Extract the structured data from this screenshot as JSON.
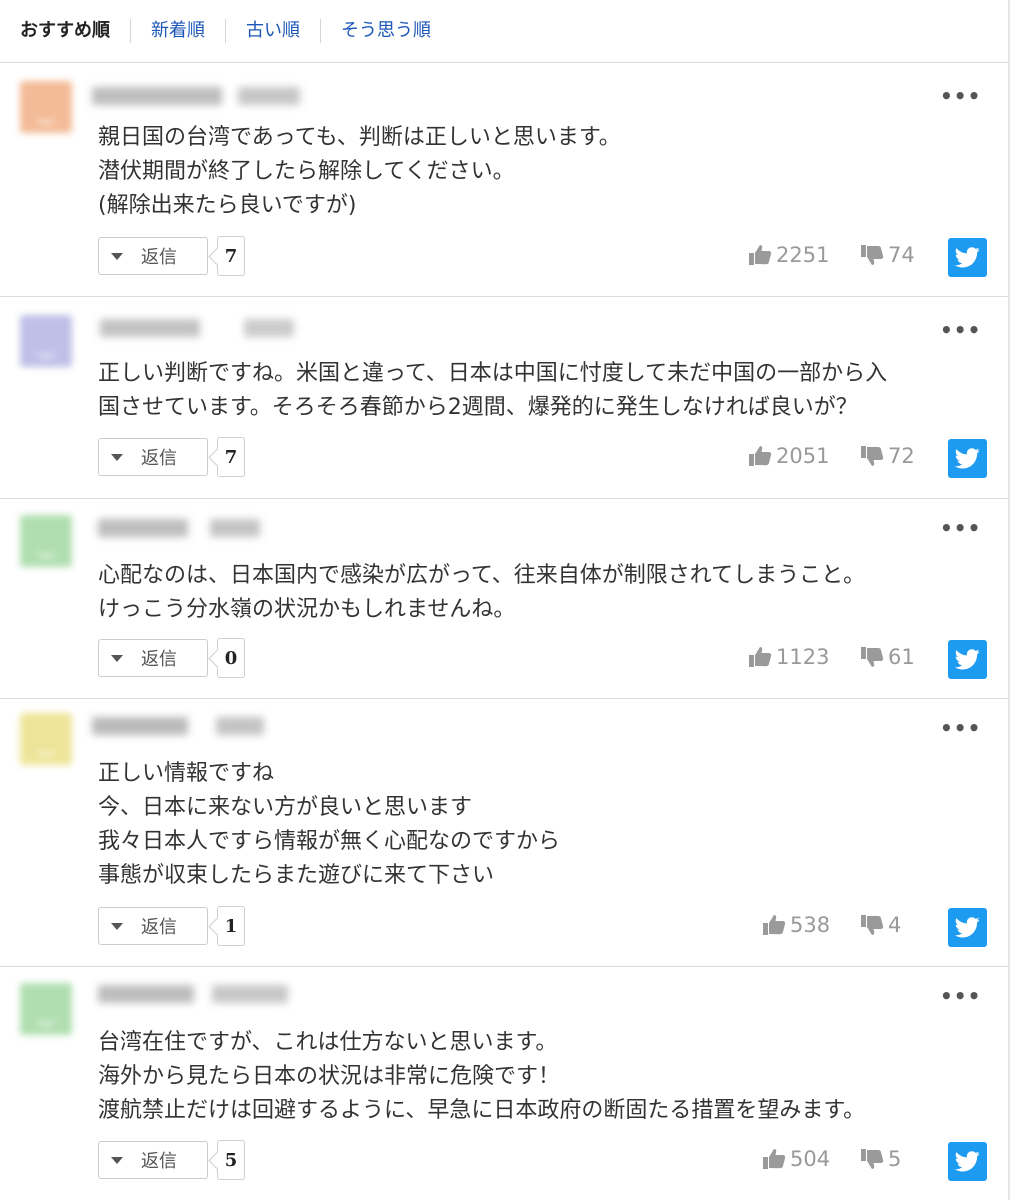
{
  "sort_tabs": [
    {
      "label": "おすすめ順",
      "active": true
    },
    {
      "label": "新着順",
      "active": false
    },
    {
      "label": "古い順",
      "active": false
    },
    {
      "label": "そう思う順",
      "active": false
    }
  ],
  "labels": {
    "reply": "返信",
    "more": "•••"
  },
  "colors": {
    "twitter": "#1d9bf0",
    "link": "#1c57b8",
    "vote": "#999999"
  },
  "comments": [
    {
      "text": "親日国の台湾であっても、判断は正しいと思います。\n潜伏期間が終了したら解除してください。\n(解除出来たら良いですが)",
      "replies": "7",
      "likes": "2251",
      "dislikes": "74"
    },
    {
      "text": "正しい判断ですね。米国と違って、日本は中国に忖度して未だ中国の一部から入\n国させています。そろそろ春節から2週間、爆発的に発生しなければ良いが？",
      "replies": "7",
      "likes": "2051",
      "dislikes": "72"
    },
    {
      "text": "心配なのは、日本国内で感染が広がって、往来自体が制限されてしまうこと。\nけっこう分水嶺の状況かもしれませんね。",
      "replies": "0",
      "likes": "1123",
      "dislikes": "61"
    },
    {
      "text": "正しい情報ですね\n今、日本に来ない方が良いと思います\n我々日本人ですら情報が無く心配なのですから\n事態が収束したらまた遊びに来て下さい",
      "replies": "1",
      "likes": "538",
      "dislikes": "4"
    },
    {
      "text": "台湾在住ですが、これは仕方ないと思います。\n海外から見たら日本の状況は非常に危険です！\n渡航禁止だけは回避するように、早急に日本政府の断固たる措置を望みます。",
      "replies": "5",
      "likes": "504",
      "dislikes": "5"
    }
  ]
}
